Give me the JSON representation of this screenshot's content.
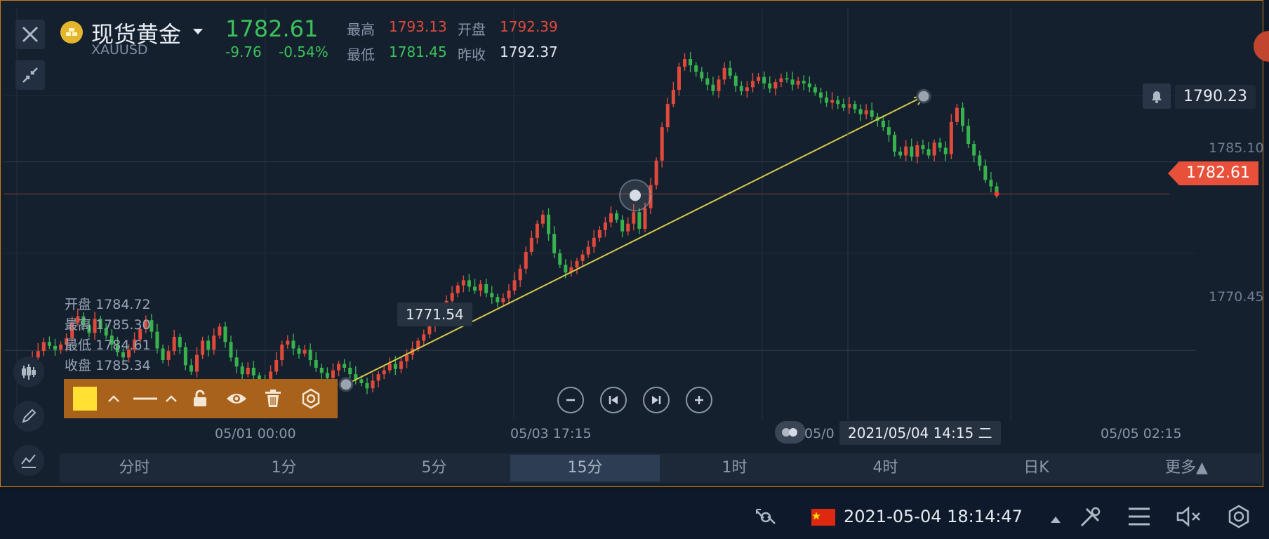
{
  "header": {
    "title": "现货黄金",
    "symbol": "XAUUSD",
    "price": "1782.61",
    "change": "-9.76",
    "change_pct": "-0.54%",
    "high_label": "最高",
    "high_value": "1793.13",
    "open_label": "开盘",
    "open_value": "1792.39",
    "low_label": "最低",
    "low_value": "1781.45",
    "prev_close_label": "昨收",
    "prev_close_value": "1792.37"
  },
  "ohlc_tooltip": {
    "open_label": "开盘",
    "open_value": "1784.72",
    "high_label": "最高",
    "high_value": "1785.30",
    "low_label": "最低",
    "low_value": "1784.61",
    "close_label": "收盘",
    "close_value": "1785.34"
  },
  "drawing": {
    "line_start_label": "1771.54",
    "alert_price": "1790.23"
  },
  "chart_data": {
    "type": "candlestick",
    "title": "",
    "ylim": [
      1765.5,
      1795.5
    ],
    "y_ticks": [
      {
        "value": 1785.1,
        "label": "1785.10"
      },
      {
        "value": 1770.45,
        "label": "1770.45"
      }
    ],
    "current_price": {
      "value": 1782.61,
      "label": "1782.61"
    },
    "x_ticks": [
      "05/01 00:00",
      "05/03 17:15",
      "05/05 02:15"
    ],
    "crosshair_time": "2021/05/04 14:15 二",
    "crosshair_partial": "05/0",
    "grid": true,
    "trend_line": {
      "from": 1767.8,
      "to": 1790.2,
      "mid": 1782.5
    },
    "close_series": [
      1768.6,
      1769.2,
      1769.9,
      1770.4,
      1771.1,
      1770.8,
      1770.5,
      1770.9,
      1771.4,
      1772.6,
      1773.1,
      1772.4,
      1771.8,
      1772.9,
      1772.2,
      1771.6,
      1770.9,
      1770.3,
      1769.9,
      1770.5,
      1771.3,
      1772.1,
      1772.8,
      1771.9,
      1770.6,
      1769.7,
      1770.4,
      1771.5,
      1770.7,
      1769.3,
      1768.8,
      1770.1,
      1771.2,
      1770.5,
      1771.6,
      1772.3,
      1771.1,
      1769.9,
      1769.2,
      1768.6,
      1769.1,
      1768.5,
      1768.2,
      1767.9,
      1768.8,
      1769.7,
      1770.9,
      1771.2,
      1770.6,
      1770.2,
      1770.5,
      1769.7,
      1769.1,
      1768.7,
      1768.3,
      1768.9,
      1769.4,
      1769.1,
      1768.6,
      1768.2,
      1767.9,
      1767.5,
      1768.1,
      1768.6,
      1768.9,
      1769.4,
      1769.0,
      1769.6,
      1770.1,
      1770.6,
      1771.2,
      1771.7,
      1772.4,
      1773.2,
      1773.8,
      1774.3,
      1774.9,
      1775.5,
      1775.9,
      1775.4,
      1775.1,
      1775.6,
      1774.9,
      1774.6,
      1774.2,
      1774.5,
      1775.1,
      1775.9,
      1776.8,
      1778.1,
      1779.2,
      1780.3,
      1781.0,
      1779.5,
      1778.0,
      1777.1,
      1776.5,
      1776.9,
      1777.4,
      1777.9,
      1778.5,
      1779.2,
      1779.8,
      1780.4,
      1781.1,
      1780.6,
      1779.7,
      1780.3,
      1781.2,
      1779.9,
      1781.5,
      1783.3,
      1785.2,
      1787.8,
      1789.6,
      1790.7,
      1792.5,
      1793.1,
      1792.6,
      1792.1,
      1791.6,
      1791.1,
      1790.6,
      1791.5,
      1792.4,
      1791.8,
      1791.0,
      1790.6,
      1790.9,
      1791.4,
      1791.7,
      1791.2,
      1790.8,
      1791.3,
      1791.6,
      1791.5,
      1791.1,
      1791.4,
      1791.2,
      1790.9,
      1790.5,
      1790.1,
      1789.7,
      1789.9,
      1789.6,
      1789.3,
      1789.6,
      1789.2,
      1788.8,
      1789.1,
      1788.6,
      1788.3,
      1787.8,
      1787.2,
      1785.9,
      1785.6,
      1786.3,
      1785.5,
      1786.4,
      1786.1,
      1785.6,
      1786.6,
      1786.2,
      1785.7,
      1788.2,
      1789.3,
      1787.9,
      1786.5,
      1785.6,
      1784.8,
      1783.7,
      1783.2,
      1782.61
    ]
  },
  "controls": {
    "zoom_out": "−",
    "step_back": "⏮",
    "step_forward": "⏭",
    "zoom_in": "+"
  },
  "tabs": [
    "分时",
    "1分",
    "5分",
    "15分",
    "1时",
    "4时",
    "日K",
    "更多▲"
  ],
  "active_tab": "15分",
  "toolbar": {
    "color_swatch": "#ffe033",
    "icons": [
      "caret-up-icon",
      "line-style-icon",
      "caret-up-icon",
      "unlock-icon",
      "eye-icon",
      "trash-icon",
      "settings-icon"
    ]
  },
  "system_bar": {
    "datetime": "2021-05-04 18:14:47",
    "flag": "cn-flag"
  },
  "colors": {
    "up": "#e04a3a",
    "down": "#37b24d",
    "accent_orange": "#c47a1c",
    "price_tag": "#e8503a",
    "trend_line": "#d4c84a"
  }
}
